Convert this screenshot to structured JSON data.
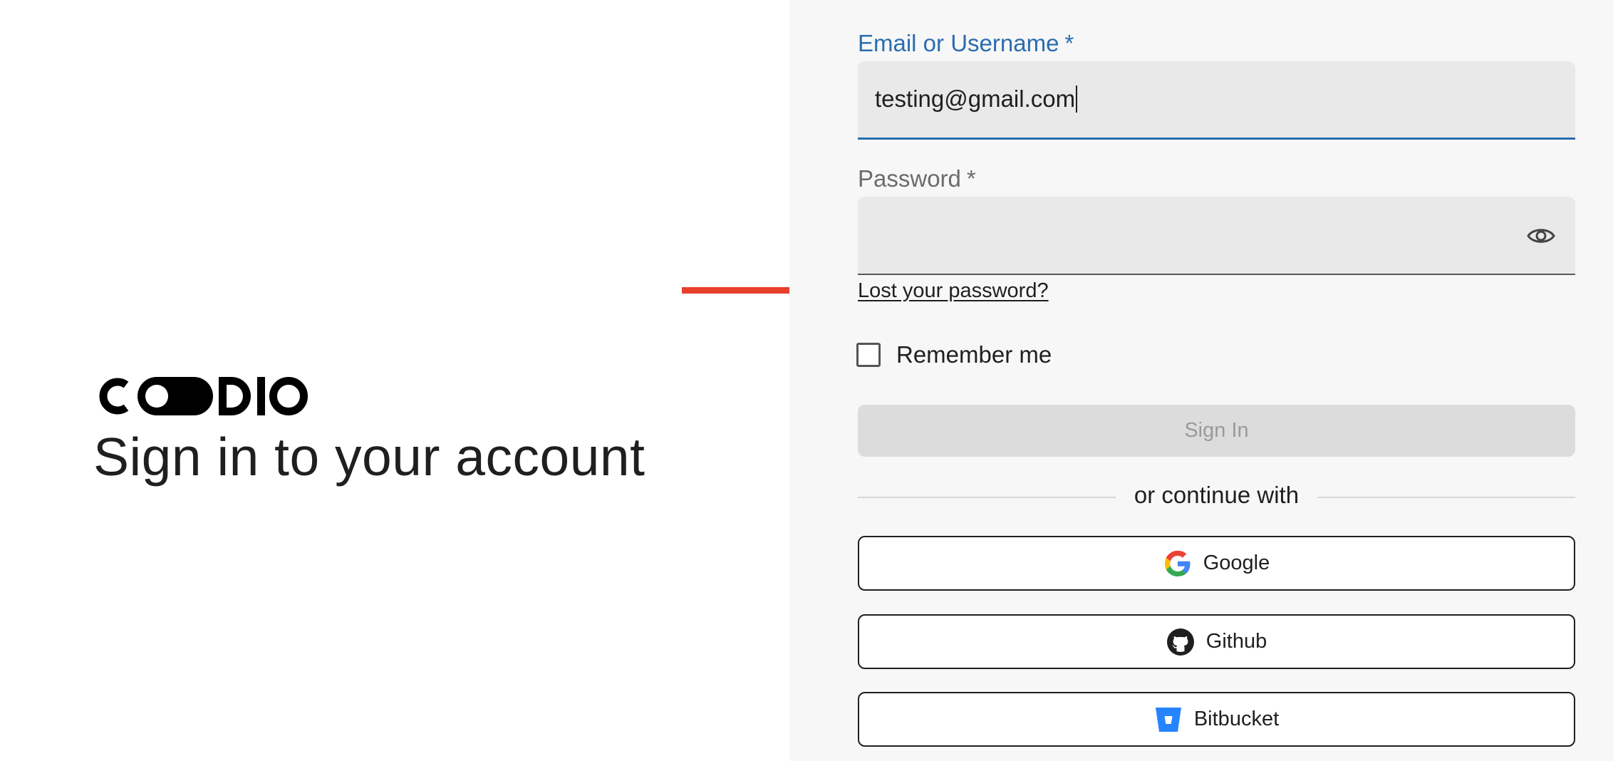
{
  "brand": {
    "logo_text": "CODIO",
    "headline": "Sign in to your account"
  },
  "form": {
    "email": {
      "label": "Email or Username",
      "required_marker": "*",
      "value": "testing@gmail.com"
    },
    "password": {
      "label": "Password",
      "required_marker": "*",
      "value": "",
      "toggle_icon": "eye-icon"
    },
    "lost_password": "Lost your password?",
    "remember_me": {
      "label": "Remember me",
      "checked": false
    },
    "sign_in": "Sign In"
  },
  "divider": {
    "text": "or continue with"
  },
  "oauth": [
    {
      "label": "Google",
      "icon": "google-icon"
    },
    {
      "label": "Github",
      "icon": "github-icon"
    },
    {
      "label": "Bitbucket",
      "icon": "bitbucket-icon"
    }
  ],
  "annotation": {
    "arrow_color": "#e8402a"
  },
  "colors": {
    "accent": "#2b6cb0",
    "panel": "#f7f7f7",
    "input_bg": "#e9e9e9",
    "disabled_button": "#dcdcdc"
  }
}
